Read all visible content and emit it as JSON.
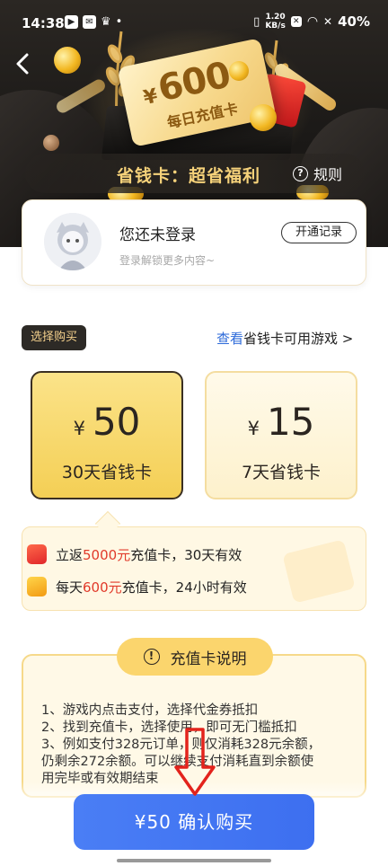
{
  "status_bar": {
    "time": "14:38",
    "net_speed_value": "1.20",
    "net_speed_unit": "KB/s",
    "battery": "40%"
  },
  "hero": {
    "ticket_currency": "¥",
    "ticket_amount": "600",
    "ticket_subtitle": "每日充值卡",
    "banner_title": "省钱卡：超省福利",
    "rules_label": "规则"
  },
  "user": {
    "name": "您还未登录",
    "hint": "登录解锁更多内容~",
    "history_button": "开通记录"
  },
  "purchase": {
    "select_tag": "选择购买",
    "view_link_highlight": "查看",
    "view_link_rest": "省钱卡可用游戏 >",
    "plans": [
      {
        "currency": "¥",
        "price": "50",
        "name": "30天省钱卡",
        "selected": true
      },
      {
        "currency": "¥",
        "price": "15",
        "name": "7天省钱卡",
        "selected": false
      }
    ]
  },
  "benefits": [
    {
      "prefix": "立返",
      "highlight": "5000元",
      "suffix": "充值卡，30天有效"
    },
    {
      "prefix": "每天",
      "highlight": "600元",
      "suffix": "充值卡，24小时有效"
    }
  ],
  "explanation": {
    "title": "充值卡说明",
    "lines": [
      "1、游戏内点击支付，选择代金券抵扣",
      "2、找到充值卡，选择使用，即可无门槛抵扣",
      "3、例如支付328元订单，则仅消耗328元余额，",
      "仍剩余272余额。可以继续支付消耗直到余额使",
      "用完毕或有效期结束"
    ]
  },
  "confirm_button": "¥50 确认购买",
  "colors": {
    "accent_blue": "#3d6ff0",
    "gold": "#f4cf55",
    "highlight_red": "#e13a2a",
    "annotation_red": "#e3231c"
  }
}
